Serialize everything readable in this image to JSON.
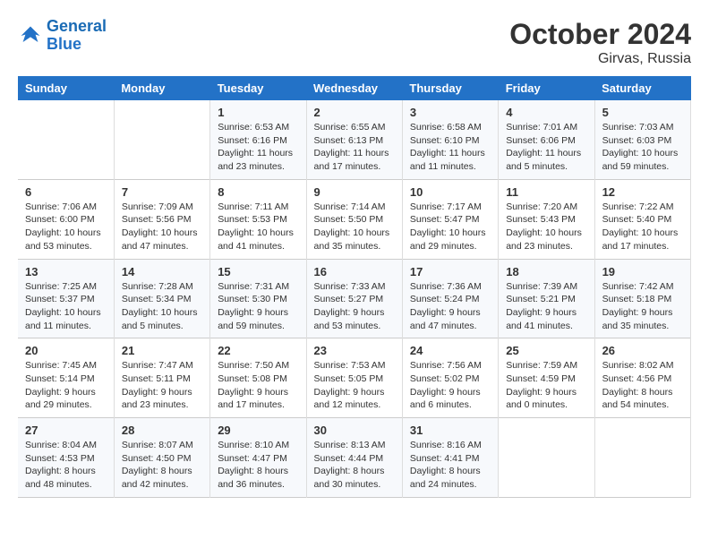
{
  "header": {
    "logo_line1": "General",
    "logo_line2": "Blue",
    "month": "October 2024",
    "location": "Girvas, Russia"
  },
  "days_of_week": [
    "Sunday",
    "Monday",
    "Tuesday",
    "Wednesday",
    "Thursday",
    "Friday",
    "Saturday"
  ],
  "weeks": [
    [
      {
        "day": "",
        "content": ""
      },
      {
        "day": "",
        "content": ""
      },
      {
        "day": "1",
        "content": "Sunrise: 6:53 AM\nSunset: 6:16 PM\nDaylight: 11 hours and 23 minutes."
      },
      {
        "day": "2",
        "content": "Sunrise: 6:55 AM\nSunset: 6:13 PM\nDaylight: 11 hours and 17 minutes."
      },
      {
        "day": "3",
        "content": "Sunrise: 6:58 AM\nSunset: 6:10 PM\nDaylight: 11 hours and 11 minutes."
      },
      {
        "day": "4",
        "content": "Sunrise: 7:01 AM\nSunset: 6:06 PM\nDaylight: 11 hours and 5 minutes."
      },
      {
        "day": "5",
        "content": "Sunrise: 7:03 AM\nSunset: 6:03 PM\nDaylight: 10 hours and 59 minutes."
      }
    ],
    [
      {
        "day": "6",
        "content": "Sunrise: 7:06 AM\nSunset: 6:00 PM\nDaylight: 10 hours and 53 minutes."
      },
      {
        "day": "7",
        "content": "Sunrise: 7:09 AM\nSunset: 5:56 PM\nDaylight: 10 hours and 47 minutes."
      },
      {
        "day": "8",
        "content": "Sunrise: 7:11 AM\nSunset: 5:53 PM\nDaylight: 10 hours and 41 minutes."
      },
      {
        "day": "9",
        "content": "Sunrise: 7:14 AM\nSunset: 5:50 PM\nDaylight: 10 hours and 35 minutes."
      },
      {
        "day": "10",
        "content": "Sunrise: 7:17 AM\nSunset: 5:47 PM\nDaylight: 10 hours and 29 minutes."
      },
      {
        "day": "11",
        "content": "Sunrise: 7:20 AM\nSunset: 5:43 PM\nDaylight: 10 hours and 23 minutes."
      },
      {
        "day": "12",
        "content": "Sunrise: 7:22 AM\nSunset: 5:40 PM\nDaylight: 10 hours and 17 minutes."
      }
    ],
    [
      {
        "day": "13",
        "content": "Sunrise: 7:25 AM\nSunset: 5:37 PM\nDaylight: 10 hours and 11 minutes."
      },
      {
        "day": "14",
        "content": "Sunrise: 7:28 AM\nSunset: 5:34 PM\nDaylight: 10 hours and 5 minutes."
      },
      {
        "day": "15",
        "content": "Sunrise: 7:31 AM\nSunset: 5:30 PM\nDaylight: 9 hours and 59 minutes."
      },
      {
        "day": "16",
        "content": "Sunrise: 7:33 AM\nSunset: 5:27 PM\nDaylight: 9 hours and 53 minutes."
      },
      {
        "day": "17",
        "content": "Sunrise: 7:36 AM\nSunset: 5:24 PM\nDaylight: 9 hours and 47 minutes."
      },
      {
        "day": "18",
        "content": "Sunrise: 7:39 AM\nSunset: 5:21 PM\nDaylight: 9 hours and 41 minutes."
      },
      {
        "day": "19",
        "content": "Sunrise: 7:42 AM\nSunset: 5:18 PM\nDaylight: 9 hours and 35 minutes."
      }
    ],
    [
      {
        "day": "20",
        "content": "Sunrise: 7:45 AM\nSunset: 5:14 PM\nDaylight: 9 hours and 29 minutes."
      },
      {
        "day": "21",
        "content": "Sunrise: 7:47 AM\nSunset: 5:11 PM\nDaylight: 9 hours and 23 minutes."
      },
      {
        "day": "22",
        "content": "Sunrise: 7:50 AM\nSunset: 5:08 PM\nDaylight: 9 hours and 17 minutes."
      },
      {
        "day": "23",
        "content": "Sunrise: 7:53 AM\nSunset: 5:05 PM\nDaylight: 9 hours and 12 minutes."
      },
      {
        "day": "24",
        "content": "Sunrise: 7:56 AM\nSunset: 5:02 PM\nDaylight: 9 hours and 6 minutes."
      },
      {
        "day": "25",
        "content": "Sunrise: 7:59 AM\nSunset: 4:59 PM\nDaylight: 9 hours and 0 minutes."
      },
      {
        "day": "26",
        "content": "Sunrise: 8:02 AM\nSunset: 4:56 PM\nDaylight: 8 hours and 54 minutes."
      }
    ],
    [
      {
        "day": "27",
        "content": "Sunrise: 8:04 AM\nSunset: 4:53 PM\nDaylight: 8 hours and 48 minutes."
      },
      {
        "day": "28",
        "content": "Sunrise: 8:07 AM\nSunset: 4:50 PM\nDaylight: 8 hours and 42 minutes."
      },
      {
        "day": "29",
        "content": "Sunrise: 8:10 AM\nSunset: 4:47 PM\nDaylight: 8 hours and 36 minutes."
      },
      {
        "day": "30",
        "content": "Sunrise: 8:13 AM\nSunset: 4:44 PM\nDaylight: 8 hours and 30 minutes."
      },
      {
        "day": "31",
        "content": "Sunrise: 8:16 AM\nSunset: 4:41 PM\nDaylight: 8 hours and 24 minutes."
      },
      {
        "day": "",
        "content": ""
      },
      {
        "day": "",
        "content": ""
      }
    ]
  ]
}
